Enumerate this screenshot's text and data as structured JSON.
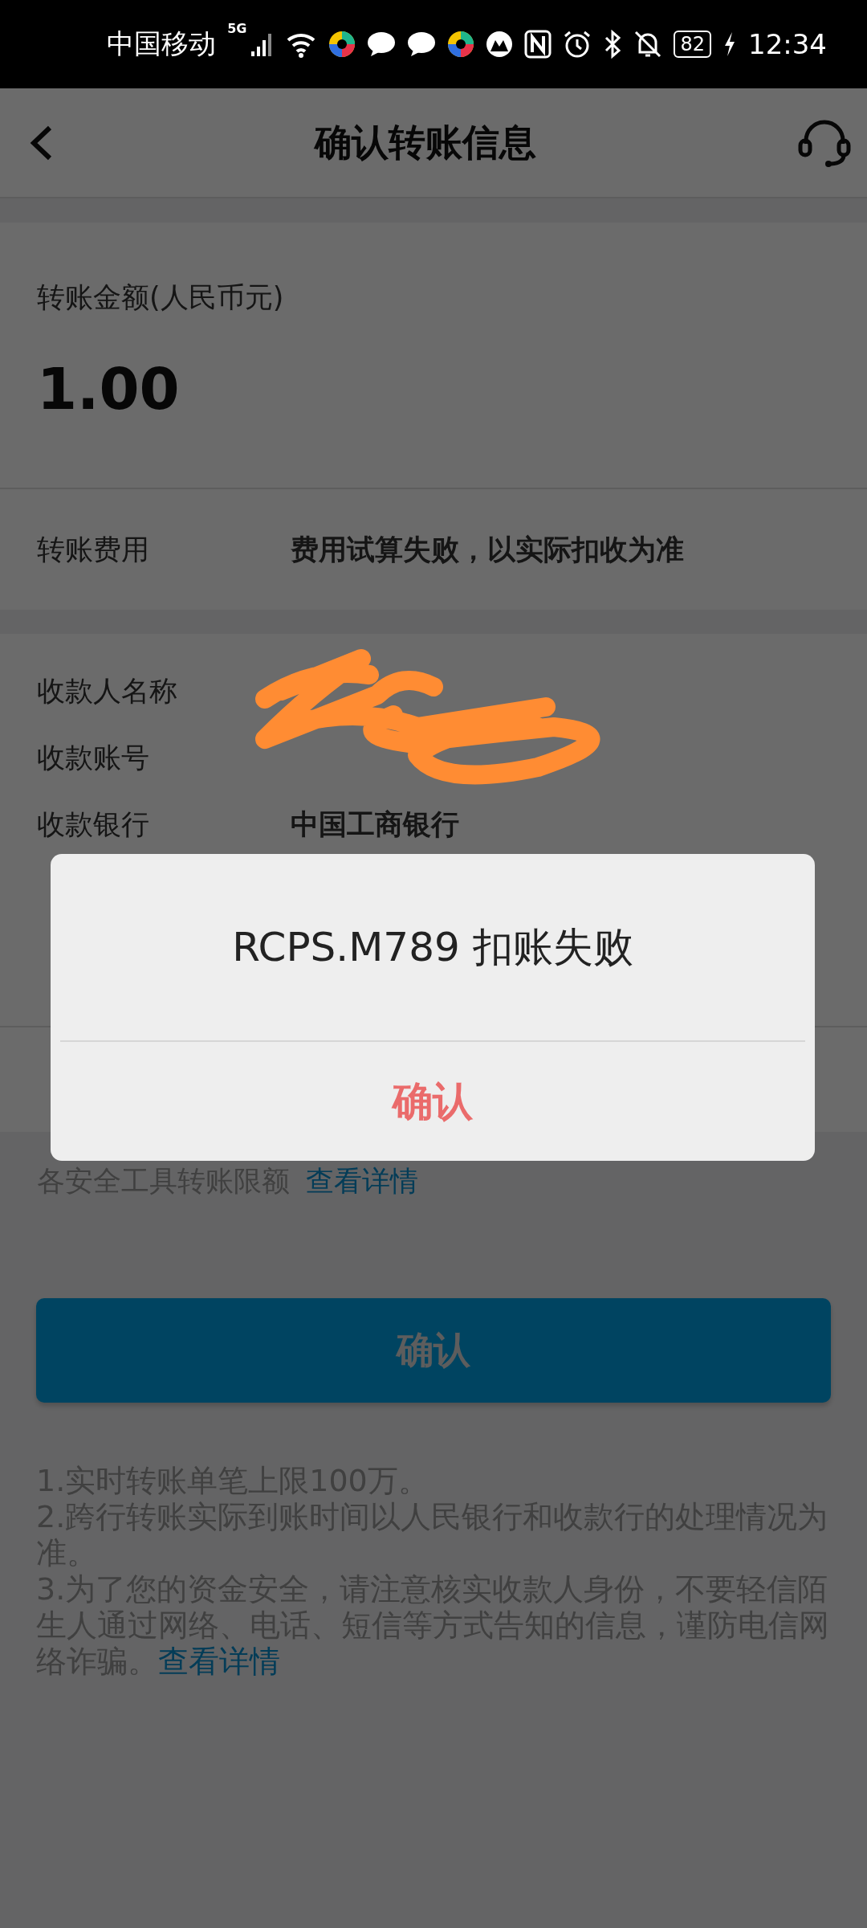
{
  "status_bar": {
    "carrier": "中国移动",
    "network": "5G",
    "battery": "82",
    "time": "12:34"
  },
  "header": {
    "title": "确认转账信息"
  },
  "amount": {
    "label": "转账金额(人民币元)",
    "value": "1.00"
  },
  "fee": {
    "label": "转账费用",
    "value": "费用试算失败，以实际扣收为准"
  },
  "details": [
    {
      "label": "收款人名称"
    },
    {
      "label": "收款账号"
    },
    {
      "label": "收款银行",
      "value": "中国工商银行"
    }
  ],
  "limit_note": {
    "text": "各安全工具转账限额",
    "link": "查看详情"
  },
  "confirm_button": "确认",
  "notes": [
    {
      "text": "1.实时转账单笔上限100万。"
    },
    {
      "text": "2.跨行转账实际到账时间以人民银行和收款行的处理情况为准。"
    },
    {
      "text": "3.为了您的资金安全，请注意核实收款人身份，不要轻信陌生人通过网络、电话、短信等方式告知的信息，谨防电信网络诈骗。",
      "link": "查看详情"
    }
  ],
  "dialog": {
    "message": "RCPS.M789 扣账失败",
    "button": "确认"
  }
}
